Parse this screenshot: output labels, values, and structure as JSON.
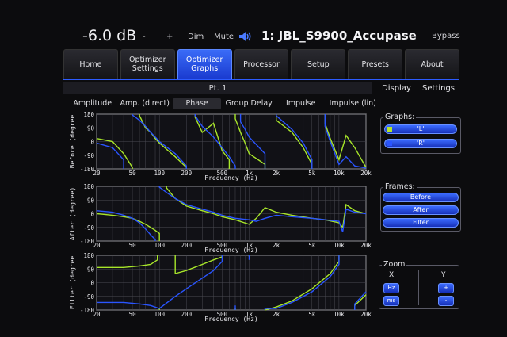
{
  "header": {
    "volume": "-6.0 dB",
    "minus_label": "-",
    "plus_label": "+",
    "dim_label": "Dim",
    "mute_label": "Mute",
    "speaker_icon": "speaker-icon",
    "preset_title": "1: JBL_S9900_Accupase",
    "bypass_label": "Bypass"
  },
  "nav": {
    "tabs": [
      {
        "label": "Home"
      },
      {
        "label": "Optimizer Settings"
      },
      {
        "label": "Optimizer Graphs"
      },
      {
        "label": "Processor"
      },
      {
        "label": "Setup"
      },
      {
        "label": "Presets"
      },
      {
        "label": "About"
      }
    ],
    "active_index": 2
  },
  "subheader": {
    "point_label": "Pt. 1",
    "display_label": "Display",
    "settings_label": "Settings"
  },
  "graph_tabs": [
    "Amplitude",
    "Amp. (direct)",
    "Phase",
    "Group Delay",
    "Impulse",
    "Impulse (lin)"
  ],
  "active_graph_tab": 2,
  "graphs_panel": {
    "title": "Graphs:",
    "items": [
      {
        "label": "'L'",
        "color": "#b6e62a"
      },
      {
        "label": "'R'",
        "color": "#2a55ff"
      }
    ]
  },
  "frames_panel": {
    "title": "Frames:",
    "buttons": [
      "Before",
      "After",
      "Filter"
    ]
  },
  "zoom_panel": {
    "title": "Zoom",
    "x_label": "X",
    "y_label": "Y",
    "x_buttons": [
      "Hz",
      "ms"
    ],
    "y_buttons": [
      "+",
      "-"
    ]
  },
  "chart_data": [
    {
      "type": "line",
      "ylabel": "Before (degree",
      "xlabel": "Frequency (Hz)",
      "x_scale": "log",
      "xlim": [
        20,
        20000
      ],
      "ylim": [
        -180,
        180
      ],
      "yticks": [
        180,
        90,
        0,
        -90,
        -180
      ],
      "xticks": [
        20,
        50,
        100,
        200,
        500,
        1000,
        2000,
        5000,
        10000,
        20000
      ],
      "xtick_labels": [
        "20",
        "50",
        "100",
        "200",
        "500",
        "1k",
        "2k",
        "5k",
        "10k",
        "20k"
      ],
      "series": [
        {
          "color": "#a8e62a",
          "x": [
            20,
            30,
            40,
            50,
            60,
            70,
            80,
            90,
            100,
            150,
            200,
            250,
            300,
            400,
            500,
            600,
            700,
            800,
            900,
            1000,
            1500,
            2000,
            3000,
            4000,
            5000,
            7000,
            8000,
            10000,
            12000,
            15000,
            20000
          ],
          "y": [
            20,
            0,
            -80,
            -170,
            170,
            90,
            60,
            20,
            -10,
            -100,
            -170,
            160,
            60,
            120,
            -60,
            -120,
            150,
            60,
            -10,
            -80,
            -150,
            140,
            60,
            -40,
            -150,
            120,
            20,
            -120,
            40,
            -40,
            -170
          ]
        },
        {
          "color": "#2a55ff",
          "x": [
            20,
            30,
            40,
            50,
            60,
            70,
            80,
            90,
            100,
            150,
            200,
            250,
            300,
            400,
            500,
            600,
            700,
            800,
            900,
            1000,
            1500,
            2000,
            3000,
            4000,
            5000,
            7000,
            8000,
            10000,
            12000,
            15000,
            20000
          ],
          "y": [
            -10,
            -40,
            -120,
            175,
            140,
            100,
            60,
            30,
            0,
            -80,
            -160,
            170,
            100,
            30,
            -40,
            -100,
            -160,
            130,
            80,
            30,
            -80,
            170,
            80,
            -10,
            -120,
            100,
            0,
            -150,
            -100,
            -160,
            -175
          ]
        }
      ]
    },
    {
      "type": "line",
      "ylabel": "After (degree)",
      "xlabel": "Frequency (Hz)",
      "x_scale": "log",
      "xlim": [
        20,
        20000
      ],
      "ylim": [
        -180,
        180
      ],
      "yticks": [
        180,
        90,
        0,
        -90,
        -180
      ],
      "xticks": [
        20,
        50,
        100,
        200,
        500,
        1000,
        2000,
        5000,
        10000,
        20000
      ],
      "xtick_labels": [
        "20",
        "50",
        "100",
        "200",
        "500",
        "1k",
        "2k",
        "5k",
        "10k",
        "20k"
      ],
      "series": [
        {
          "color": "#a8e62a",
          "x": [
            20,
            30,
            40,
            50,
            60,
            70,
            80,
            90,
            100,
            120,
            150,
            200,
            300,
            400,
            500,
            700,
            1000,
            1200,
            1500,
            2000,
            3000,
            5000,
            7000,
            10000,
            11000,
            12000,
            15000,
            20000
          ],
          "y": [
            0,
            -10,
            -20,
            -30,
            -50,
            -70,
            -90,
            -110,
            -130,
            170,
            100,
            50,
            20,
            0,
            -20,
            -40,
            -70,
            -30,
            40,
            10,
            -10,
            -30,
            -40,
            -60,
            -90,
            60,
            20,
            0
          ]
        },
        {
          "color": "#2a55ff",
          "x": [
            20,
            30,
            40,
            50,
            60,
            70,
            80,
            90,
            100,
            120,
            150,
            200,
            300,
            400,
            500,
            700,
            1000,
            1200,
            1500,
            2000,
            3000,
            5000,
            7000,
            10000,
            11000,
            12000,
            15000,
            20000
          ],
          "y": [
            20,
            10,
            -10,
            -30,
            -60,
            -100,
            -140,
            -170,
            175,
            140,
            100,
            60,
            30,
            10,
            -10,
            -30,
            -40,
            -50,
            -30,
            -10,
            -20,
            -30,
            -40,
            -50,
            -120,
            30,
            10,
            0
          ]
        }
      ]
    },
    {
      "type": "line",
      "ylabel": "Filter (degree",
      "xlabel": "Frequency (Hz)",
      "x_scale": "log",
      "xlim": [
        20,
        20000
      ],
      "ylim": [
        -180,
        180
      ],
      "yticks": [
        180,
        90,
        0,
        -90,
        -180
      ],
      "xticks": [
        20,
        50,
        100,
        200,
        500,
        1000,
        2000,
        5000,
        10000,
        20000
      ],
      "xtick_labels": [
        "20",
        "50",
        "100",
        "200",
        "500",
        "1k",
        "2k",
        "5k",
        "10k",
        "20k"
      ],
      "series": [
        {
          "color": "#a8e62a",
          "x": [
            20,
            40,
            60,
            80,
            95,
            100,
            150,
            200,
            300,
            400,
            500,
            700,
            1000,
            1500,
            2000,
            3000,
            5000,
            8000,
            10000,
            15000,
            20000
          ],
          "y": [
            100,
            100,
            110,
            120,
            150,
            -170,
            60,
            80,
            120,
            150,
            170,
            -170,
            170,
            -180,
            -160,
            -120,
            -40,
            60,
            140,
            -150,
            -80
          ]
        },
        {
          "color": "#2a55ff",
          "x": [
            20,
            40,
            60,
            80,
            100,
            150,
            200,
            300,
            400,
            500,
            700,
            1000,
            1500,
            2000,
            3000,
            5000,
            8000,
            10000,
            15000,
            20000
          ],
          "y": [
            -130,
            -130,
            -140,
            -150,
            -170,
            -90,
            -40,
            30,
            80,
            140,
            -150,
            150,
            -170,
            -170,
            -130,
            -60,
            40,
            120,
            -140,
            -60
          ]
        }
      ]
    }
  ]
}
